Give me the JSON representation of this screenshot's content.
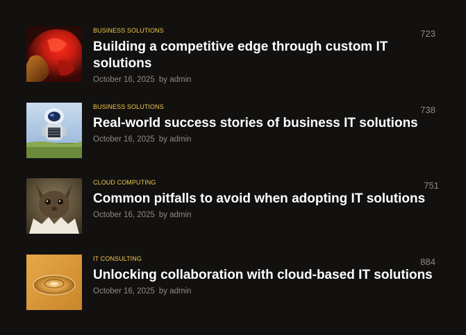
{
  "posts": [
    {
      "category": "BUSINESS SOLUTIONS",
      "title": "Building a competitive edge through custom IT solutions",
      "date": "October 16, 2025",
      "author": "by admin",
      "count": "723",
      "image": "red-abstract-sculpture"
    },
    {
      "category": "BUSINESS SOLUTIONS",
      "title": "Real-world success stories of business IT solutions",
      "date": "October 16, 2025",
      "author": "by admin",
      "count": "738",
      "image": "robot-on-grass"
    },
    {
      "category": "CLOUD COMPUTING",
      "title": "Common pitfalls to avoid when adopting IT solutions",
      "date": "October 16, 2025",
      "author": "by admin",
      "count": "751",
      "image": "creature-hatching"
    },
    {
      "category": "IT CONSULTING",
      "title": "Unlocking collaboration with cloud-based IT solutions",
      "date": "October 16, 2025",
      "author": "by admin",
      "count": "884",
      "image": "glass-disc-on-orange"
    }
  ]
}
